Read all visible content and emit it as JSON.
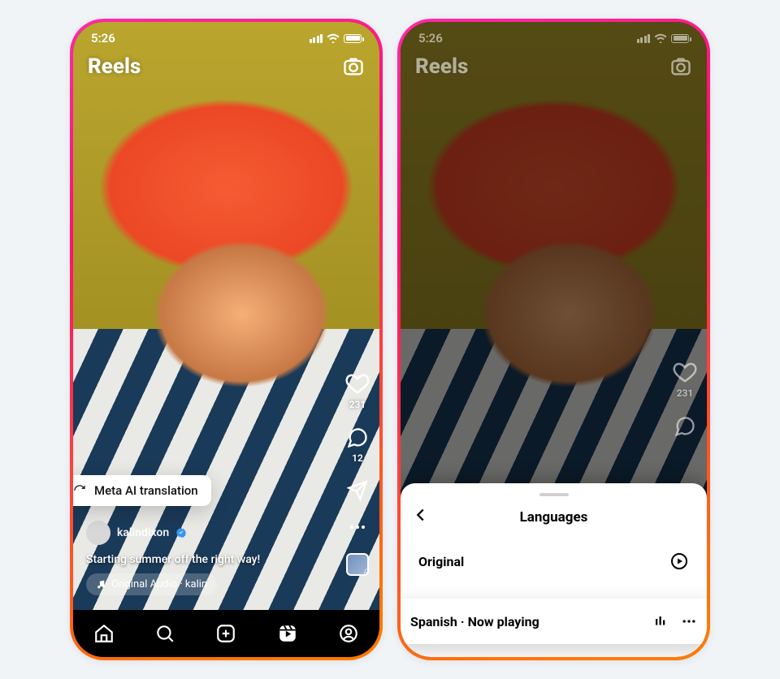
{
  "status": {
    "time": "5:26"
  },
  "header": {
    "title": "Reels"
  },
  "rail": {
    "likes": "231",
    "comments": "12"
  },
  "overlay": {
    "username": "kalindixon",
    "caption": "Starting summer off the right way!",
    "audio_label": "Original Audio · kalin",
    "translation_chip": "Meta AI translation"
  },
  "sheet": {
    "title": "Languages",
    "original_label": "Original",
    "spanish_label": "Spanish · Now playing"
  }
}
